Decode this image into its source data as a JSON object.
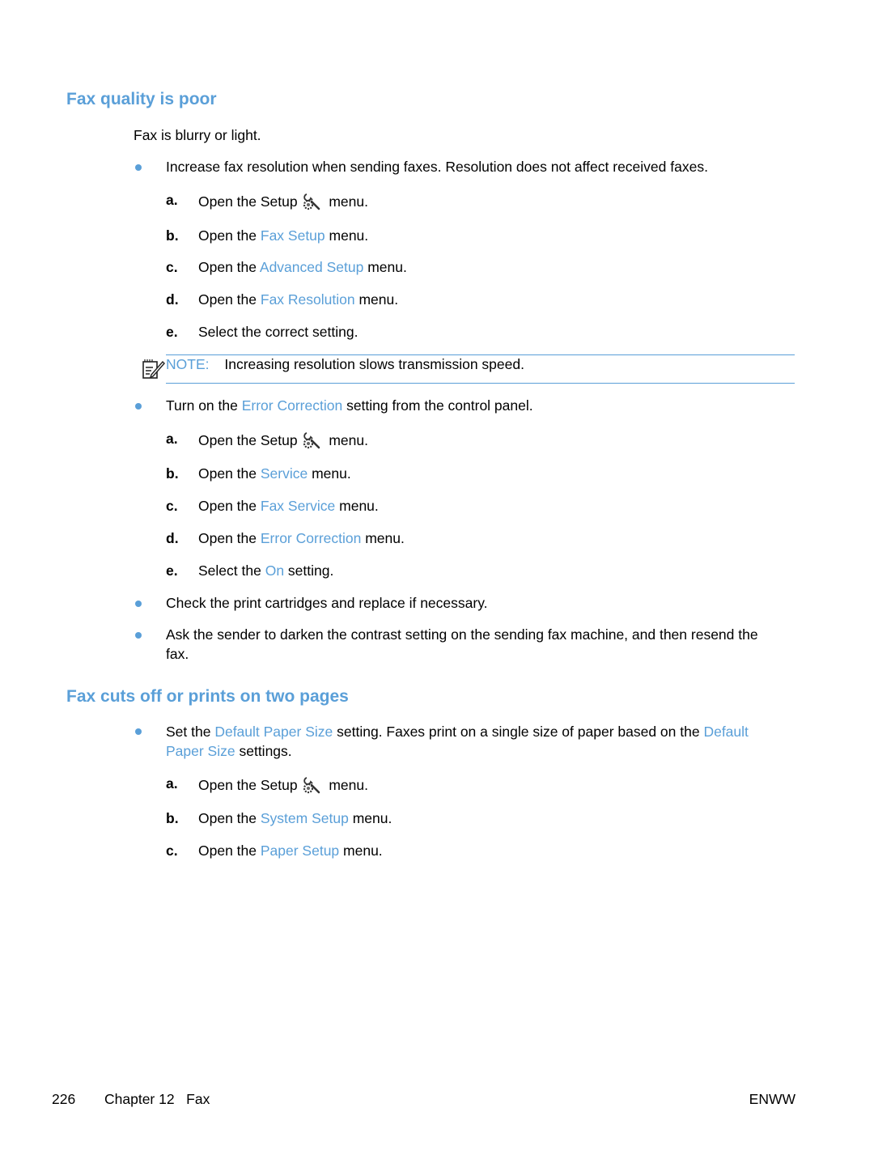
{
  "section1": {
    "title": "Fax quality is poor",
    "intro": "Fax is blurry or light.",
    "bullet1": {
      "text": "Increase fax resolution when sending faxes. Resolution does not affect received faxes.",
      "steps": [
        {
          "letter": "a.",
          "pre": "Open the Setup",
          "icon": "setup-wrench-gear-icon",
          "post": "menu."
        },
        {
          "letter": "b.",
          "pre": "Open the ",
          "link": "Fax Setup",
          "post": " menu."
        },
        {
          "letter": "c.",
          "pre": "Open the ",
          "link": "Advanced Setup",
          "post": " menu."
        },
        {
          "letter": "d.",
          "pre": "Open the ",
          "link": "Fax Resolution",
          "post": " menu."
        },
        {
          "letter": "e.",
          "pre": "Select the correct setting."
        }
      ]
    },
    "note": {
      "icon": "note-pencil-icon",
      "label": "NOTE:",
      "text": "Increasing resolution slows transmission speed."
    },
    "bullet2": {
      "pre": "Turn on the ",
      "link": "Error Correction",
      "post": " setting from the control panel.",
      "steps": [
        {
          "letter": "a.",
          "pre": "Open the Setup",
          "icon": "setup-wrench-gear-icon",
          "post": "menu."
        },
        {
          "letter": "b.",
          "pre": "Open the ",
          "link": "Service",
          "post": " menu."
        },
        {
          "letter": "c.",
          "pre": "Open the ",
          "link": "Fax Service",
          "post": " menu."
        },
        {
          "letter": "d.",
          "pre": "Open the ",
          "link": "Error Correction",
          "post": " menu."
        },
        {
          "letter": "e.",
          "pre": "Select the ",
          "link": "On",
          "post": " setting."
        }
      ]
    },
    "bullet3": {
      "text": "Check the print cartridges and replace if necessary."
    },
    "bullet4": {
      "line1": "Ask the sender to darken the contrast setting on the sending fax machine, and then resend the",
      "line2": "fax."
    }
  },
  "section2": {
    "title": "Fax cuts off or prints on two pages",
    "bullet1": {
      "pre": "Set the ",
      "link1": "Default Paper Size",
      "mid": " setting. Faxes print on a single size of paper based on the ",
      "link2a": "Default",
      "link2b": "Paper Size",
      "post": " settings.",
      "steps": [
        {
          "letter": "a.",
          "pre": "Open the Setup",
          "icon": "setup-wrench-gear-icon",
          "post": "menu."
        },
        {
          "letter": "b.",
          "pre": "Open the ",
          "link": "System Setup",
          "post": " menu."
        },
        {
          "letter": "c.",
          "pre": "Open the ",
          "link": "Paper Setup",
          "post": " menu."
        }
      ]
    }
  },
  "footer": {
    "page_number": "226",
    "chapter": "Chapter 12   Fax",
    "right": "ENWW"
  },
  "colors": {
    "accent": "#5a9fd8",
    "text": "#000000"
  }
}
